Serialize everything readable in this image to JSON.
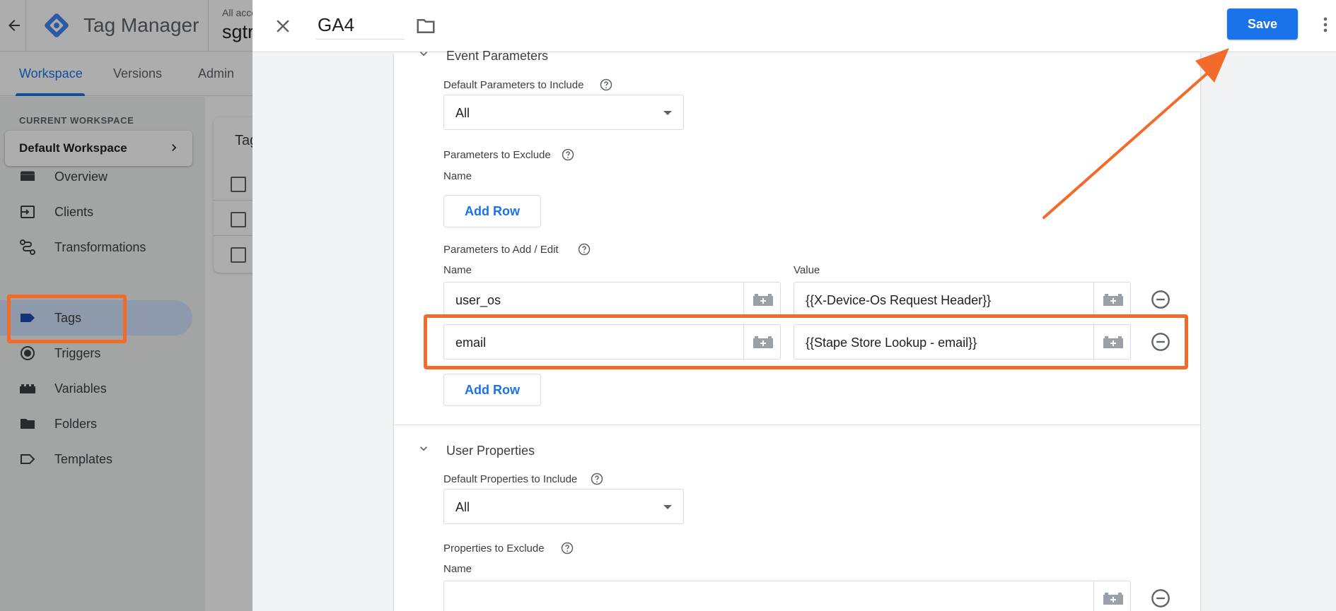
{
  "app": {
    "title": "Tag Manager",
    "account_label": "All acco",
    "account_name": "sgtr"
  },
  "nav": {
    "tabs": [
      "Workspace",
      "Versions",
      "Admin"
    ],
    "active_tab": "Workspace"
  },
  "sidebar": {
    "workspace_label": "CURRENT WORKSPACE",
    "workspace_name": "Default Workspace",
    "items": [
      {
        "label": "Overview",
        "icon": "overview-icon"
      },
      {
        "label": "Clients",
        "icon": "clients-icon"
      },
      {
        "label": "Transformations",
        "icon": "transformations-icon"
      },
      {
        "label": "Tags",
        "icon": "tag-icon",
        "active": true
      },
      {
        "label": "Triggers",
        "icon": "triggers-icon"
      },
      {
        "label": "Variables",
        "icon": "variables-icon"
      },
      {
        "label": "Folders",
        "icon": "folder-icon"
      },
      {
        "label": "Templates",
        "icon": "templates-icon"
      }
    ]
  },
  "content": {
    "title": "Tag"
  },
  "editor": {
    "tag_name": "GA4",
    "save_label": "Save",
    "event_parameters": {
      "title": "Event Parameters",
      "default_params_label": "Default Parameters to Include",
      "default_params_value": "All",
      "exclude_label": "Parameters to Exclude",
      "exclude_name_col": "Name",
      "add_row_label": "Add Row",
      "add_edit_label": "Parameters to Add / Edit",
      "name_col": "Name",
      "value_col": "Value",
      "rows": [
        {
          "name": "user_os",
          "value": "{{X-Device-Os Request Header}}"
        },
        {
          "name": "email",
          "value": "{{Stape Store Lookup - email}}"
        }
      ]
    },
    "user_properties": {
      "title": "User Properties",
      "default_props_label": "Default Properties to Include",
      "default_props_value": "All",
      "exclude_label": "Properties to Exclude",
      "exclude_name_col": "Name"
    }
  },
  "colors": {
    "accent": "#1a73e8",
    "highlight": "#f26b2a"
  }
}
